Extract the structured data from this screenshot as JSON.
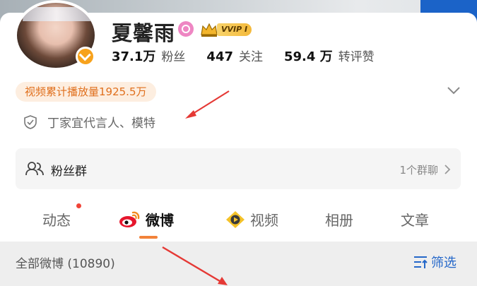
{
  "profile": {
    "name": "夏馨雨",
    "vip_label": "VVIP I",
    "stats": [
      {
        "value": "37.1万",
        "label": "粉丝"
      },
      {
        "value": "447",
        "label": "关注"
      },
      {
        "value": "59.4 万",
        "label": "转评赞"
      }
    ],
    "play_count_badge": "视频累计播放量1925.5万",
    "certification": "丁家宜代言人、模特"
  },
  "fans_group": {
    "label": "粉丝群",
    "count": "1个群聊"
  },
  "tabs": [
    {
      "label": "动态",
      "has_red_dot": true
    },
    {
      "label": "微博",
      "active": true
    },
    {
      "label": "视频"
    },
    {
      "label": "相册"
    },
    {
      "label": "文章"
    }
  ],
  "filter_bar": {
    "all_posts": "全部微博 (10890)",
    "filter_label": "筛选"
  },
  "colors": {
    "accent_orange": "#f2823a",
    "link_blue": "#2467c9",
    "badge_bg": "#fdeee0",
    "badge_text": "#e06f1c",
    "annotation_arrow": "#e53935"
  },
  "icons": [
    "avatar",
    "verified-icon",
    "pink-badge-icon",
    "crown-icon",
    "chevron-down-icon",
    "shield-icon",
    "fans-group-icon",
    "chevron-right-icon",
    "weibo-logo-icon",
    "video-icon",
    "filter-icon"
  ]
}
